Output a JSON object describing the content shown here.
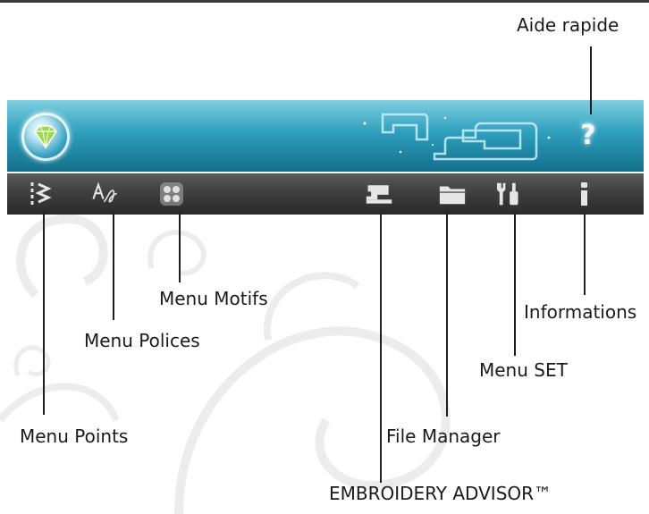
{
  "panel": {
    "help_button": "?"
  },
  "labels": {
    "aide_rapide": "Aide rapide",
    "menu_motifs": "Menu Motifs",
    "menu_polices": "Menu Polices",
    "menu_points": "Menu Points",
    "informations": "Informations",
    "menu_set": "Menu SET",
    "file_manager": "File Manager",
    "embroidery_advisor": "EMBROIDERY ADVISOR™"
  },
  "colors": {
    "panel_top": "#2f9fbd",
    "panel_bottom": "#3d3d3d",
    "icon": "#e6e6e6",
    "motif_icon": "#a8a8a8",
    "callout": "#1f1f1f"
  },
  "icons": [
    "stitch-menu-icon",
    "font-menu-icon",
    "design-menu-icon",
    "embroidery-advisor-icon",
    "folder-icon",
    "tools-icon",
    "info-icon",
    "help-icon",
    "logo-icon"
  ]
}
